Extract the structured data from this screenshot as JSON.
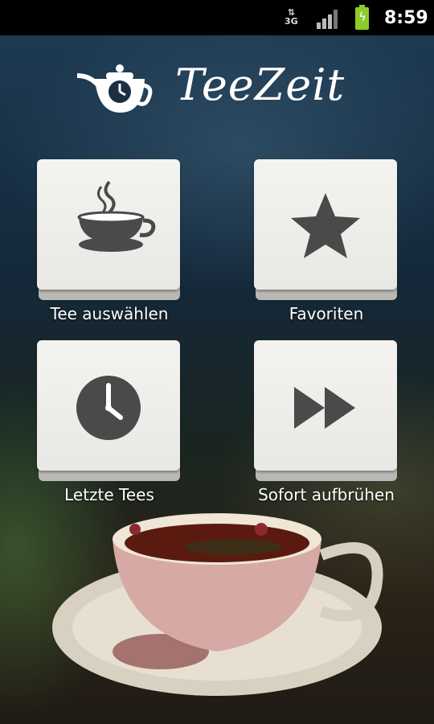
{
  "statusbar": {
    "network": "3G",
    "time": "8:59"
  },
  "app": {
    "title": "TeeZeit"
  },
  "menu": [
    {
      "label": "Tee auswählen",
      "icon": "teacup-icon"
    },
    {
      "label": "Favoriten",
      "icon": "star-icon"
    },
    {
      "label": "Letzte Tees",
      "icon": "clock-icon"
    },
    {
      "label": "Sofort aufbrühen",
      "icon": "fast-forward-icon"
    }
  ],
  "colors": {
    "tile": "#eeede9",
    "icon": "#4a4a4a",
    "battery": "#8ccc2a"
  }
}
